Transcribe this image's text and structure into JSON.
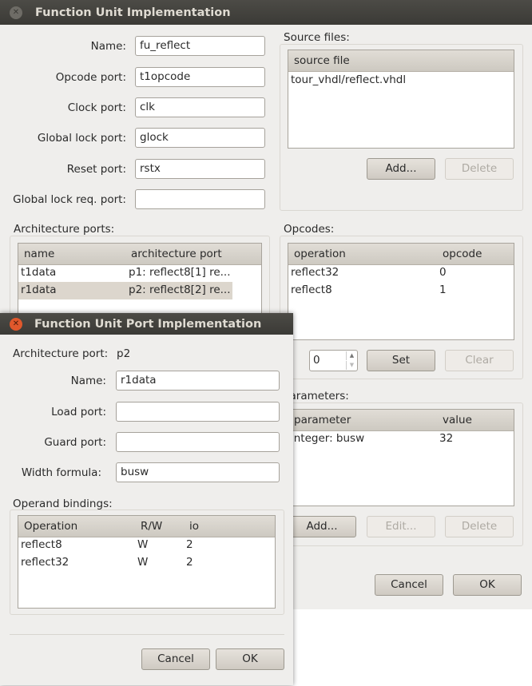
{
  "main_dialog": {
    "title": "Function Unit Implementation",
    "fields": [
      {
        "label": "Name:",
        "value": "fu_reflect"
      },
      {
        "label": "Opcode port:",
        "value": "t1opcode"
      },
      {
        "label": "Clock port:",
        "value": "clk"
      },
      {
        "label": "Global lock port:",
        "value": "glock"
      },
      {
        "label": "Reset port:",
        "value": "rstx"
      },
      {
        "label": "Global lock req. port:",
        "value": ""
      }
    ],
    "source_files": {
      "label": "Source files:",
      "column": "source file",
      "rows": [
        "tour_vhdl/reflect.vhdl"
      ],
      "add_label": "Add...",
      "delete_label": "Delete"
    },
    "architecture_ports": {
      "label": "Architecture ports:",
      "columns": [
        "name",
        "architecture port"
      ],
      "rows": [
        {
          "name": "t1data",
          "port": "p1: reflect8[1] re..."
        },
        {
          "name": "r1data",
          "port": "p2: reflect8[2] re..."
        }
      ]
    },
    "opcodes": {
      "label": "Opcodes:",
      "columns": [
        "operation",
        "opcode"
      ],
      "rows": [
        {
          "operation": "reflect32",
          "opcode": "0"
        },
        {
          "operation": "reflect8",
          "opcode": "1"
        }
      ],
      "spin_value": "0",
      "set_label": "Set",
      "clear_label": "Clear"
    },
    "parameters": {
      "label": "Parameters:",
      "columns": [
        "parameter",
        "value"
      ],
      "rows": [
        {
          "parameter": "integer: busw",
          "value": "32"
        }
      ],
      "add_label": "Add...",
      "edit_label": "Edit...",
      "delete_label": "Delete"
    },
    "cancel_label": "Cancel",
    "ok_label": "OK"
  },
  "port_dialog": {
    "title": "Function Unit Port Implementation",
    "arch_port_label": "Architecture port:",
    "arch_port_value": "p2",
    "fields": [
      {
        "label": "Name:",
        "value": "r1data"
      },
      {
        "label": "Load port:",
        "value": ""
      },
      {
        "label": "Guard port:",
        "value": ""
      },
      {
        "label": "Width formula:",
        "value": "busw"
      }
    ],
    "operand_bindings": {
      "label": "Operand bindings:",
      "columns": [
        "Operation",
        "R/W",
        "io"
      ],
      "rows": [
        {
          "operation": "reflect8",
          "rw": "W",
          "io": "2"
        },
        {
          "operation": "reflect32",
          "rw": "W",
          "io": "2"
        }
      ]
    },
    "cancel_label": "Cancel",
    "ok_label": "OK"
  },
  "colors": {
    "titlebar": "#3f3e3a",
    "window_bg": "#efeeec",
    "selection": "#dcd6cd",
    "close_button": "#e0582c"
  }
}
